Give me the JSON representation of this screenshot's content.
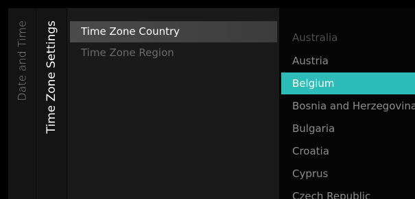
{
  "breadcrumb": {
    "parent": "Date and Time",
    "current": "Time Zone Settings"
  },
  "menu": {
    "items": [
      {
        "label": "Time Zone Country",
        "selected": true
      },
      {
        "label": "Time Zone Region",
        "selected": false
      }
    ]
  },
  "options": {
    "items": [
      {
        "label": "Australia"
      },
      {
        "label": "Austria"
      },
      {
        "label": "Belgium"
      },
      {
        "label": "Bosnia and Herzegovina"
      },
      {
        "label": "Bulgaria"
      },
      {
        "label": "Croatia"
      },
      {
        "label": "Cyprus"
      },
      {
        "label": "Czech Republic"
      }
    ],
    "selected_index": 2
  },
  "colors": {
    "accent": "#2ebcb8",
    "background": "#000000"
  }
}
